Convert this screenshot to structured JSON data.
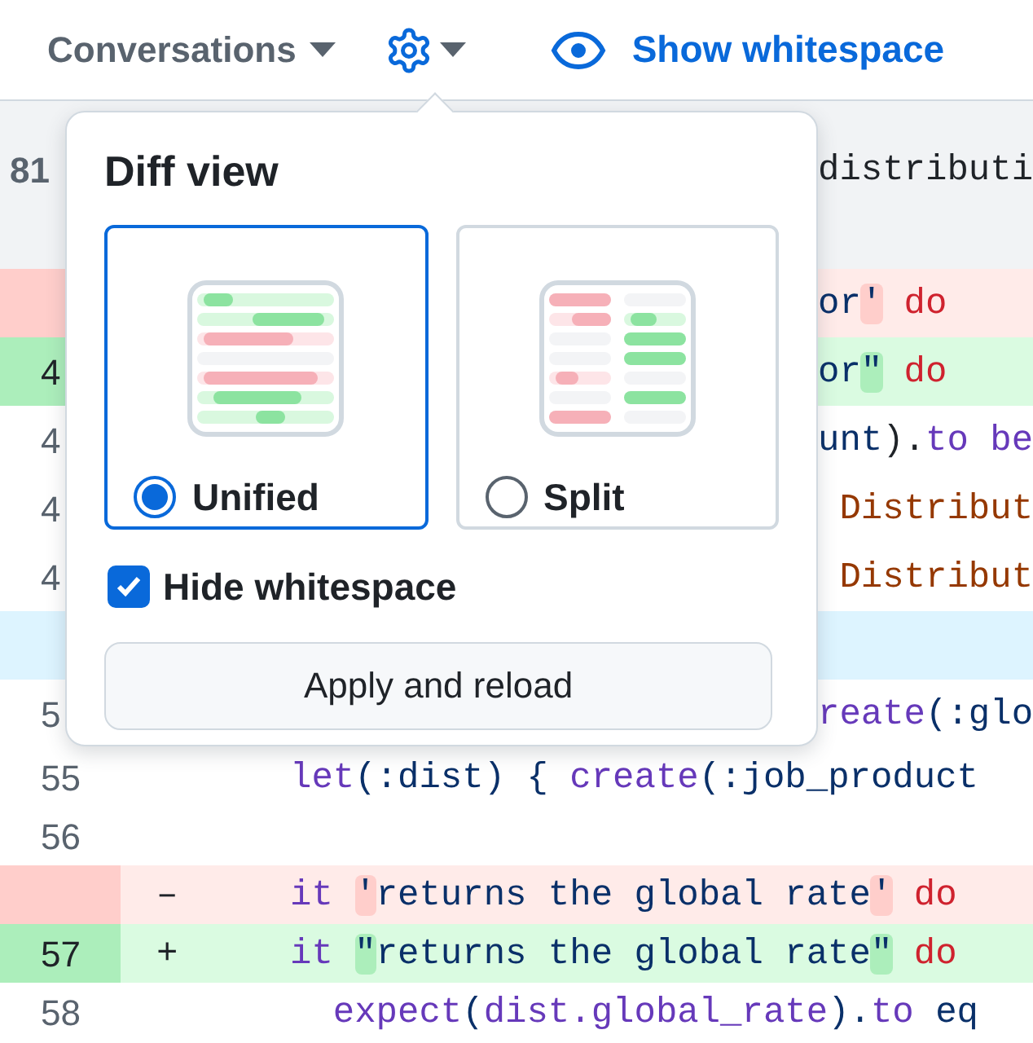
{
  "toolbar": {
    "conversations": "Conversations",
    "show_whitespace": "Show whitespace"
  },
  "diff_rows": [
    {
      "kind": "hunk",
      "number": "81",
      "tail": [
        {
          "text": "distributi",
          "kind": "plain"
        }
      ]
    },
    {
      "kind": "deletion",
      "number": "",
      "tail": [
        {
          "text": "or",
          "kind": "string"
        },
        {
          "text": "'",
          "kind": "mark"
        },
        {
          "text": " do",
          "kind": "red"
        }
      ]
    },
    {
      "kind": "addition",
      "number": "4",
      "tail": [
        {
          "text": "or",
          "kind": "string"
        },
        {
          "text": "\"",
          "kind": "mark"
        },
        {
          "text": " do",
          "kind": "red"
        }
      ]
    },
    {
      "kind": "context",
      "number": "4",
      "tail": [
        {
          "text": "unt",
          "kind": "string"
        },
        {
          "text": ").",
          "kind": "plain"
        },
        {
          "text": "to be",
          "kind": "keyword"
        }
      ]
    },
    {
      "kind": "context",
      "number": "4",
      "tail": [
        {
          "text": " Distribut",
          "kind": "constant"
        }
      ]
    },
    {
      "kind": "context",
      "number": "4",
      "tail": [
        {
          "text": " Distribut",
          "kind": "constant"
        }
      ]
    },
    {
      "kind": "expander",
      "number": "",
      "tail": []
    },
    {
      "kind": "context",
      "number": "5",
      "tail": [
        {
          "text": "reate",
          "kind": "keyword"
        },
        {
          "text": "(:glo",
          "kind": "string"
        }
      ]
    },
    {
      "kind": "context",
      "number": "55",
      "sign": "",
      "code": [
        {
          "text": "let",
          "kind": "keyword"
        },
        {
          "text": "(:dist) { ",
          "kind": "string"
        },
        {
          "text": "create",
          "kind": "keyword"
        },
        {
          "text": "(:job_product",
          "kind": "string"
        }
      ]
    },
    {
      "kind": "context",
      "number": "56",
      "sign": "",
      "code": []
    },
    {
      "kind": "deletion",
      "number": "",
      "sign": "–",
      "code": [
        {
          "text": "it ",
          "kind": "keyword"
        },
        {
          "text": "'",
          "kind": "mark"
        },
        {
          "text": "returns the global rate",
          "kind": "string"
        },
        {
          "text": "'",
          "kind": "mark"
        },
        {
          "text": " do",
          "kind": "red"
        }
      ]
    },
    {
      "kind": "addition",
      "number": "57",
      "sign": "+",
      "code": [
        {
          "text": "it ",
          "kind": "keyword"
        },
        {
          "text": "\"",
          "kind": "mark"
        },
        {
          "text": "returns the global rate",
          "kind": "string"
        },
        {
          "text": "\"",
          "kind": "mark"
        },
        {
          "text": " do",
          "kind": "red"
        }
      ]
    },
    {
      "kind": "context",
      "number": "58",
      "sign": "",
      "code": [
        {
          "text": "  expect",
          "kind": "keyword"
        },
        {
          "text": "(",
          "kind": "string"
        },
        {
          "text": "dist",
          "kind": "keyword"
        },
        {
          "text": ".global_rate",
          "kind": "keyword"
        },
        {
          "text": ").",
          "kind": "string"
        },
        {
          "text": "to",
          "kind": "keyword"
        },
        {
          "text": " eq",
          "kind": "string"
        }
      ]
    }
  ],
  "popover": {
    "title": "Diff view",
    "options": [
      {
        "label": "Unified",
        "kind": "unified",
        "selected": true
      },
      {
        "label": "Split",
        "kind": "split",
        "selected": false
      }
    ],
    "hide_whitespace": {
      "label": "Hide whitespace",
      "checked": true
    },
    "button": "Apply and reload"
  }
}
